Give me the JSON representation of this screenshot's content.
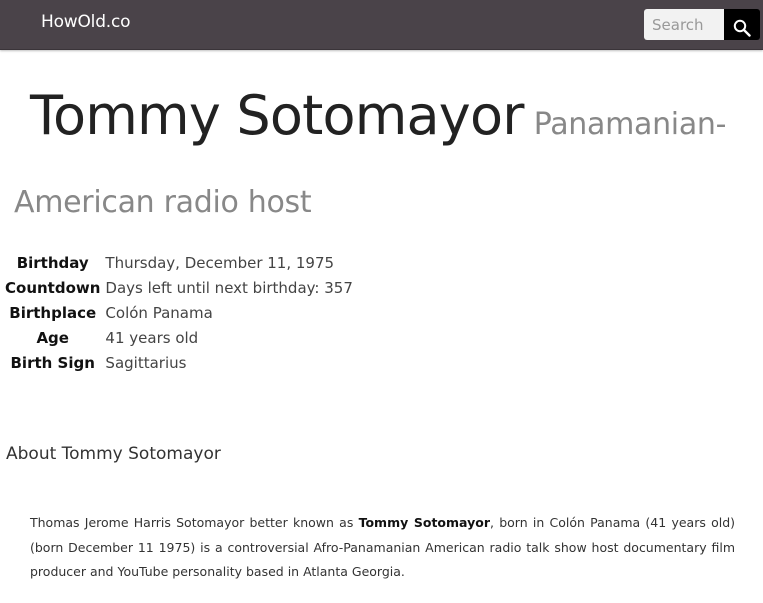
{
  "navbar": {
    "brand": "HowOld.co",
    "search": {
      "placeholder": "Search"
    }
  },
  "person": {
    "name": "Tommy Sotomayor",
    "description": "Panamanian-American radio host"
  },
  "facts": [
    {
      "label": "Birthday",
      "value": "Thursday, December 11, 1975"
    },
    {
      "label": "Countdown",
      "value": "Days left until next birthday: 357"
    },
    {
      "label": "Birthplace",
      "value": "Colón Panama"
    },
    {
      "label": "Age",
      "value": "41 years old"
    },
    {
      "label": "Birth Sign",
      "value": "Sagittarius"
    }
  ],
  "about": {
    "heading": "About Tommy Sotomayor",
    "text_before": "Thomas Jerome Harris Sotomayor better known as ",
    "text_bold": "Tommy Sotomayor",
    "text_after": ", born in Colón Panama (41 years old) (born December 11 1975) is a controversial Afro-Panamanian American radio talk show host documentary film producer and YouTube personality based in Atlanta Georgia."
  },
  "icons": {
    "search_button": "search-icon"
  },
  "colors": {
    "navbar_bg": "#4a4349",
    "search_button_bg": "#000000",
    "subtitle": "#888888"
  }
}
